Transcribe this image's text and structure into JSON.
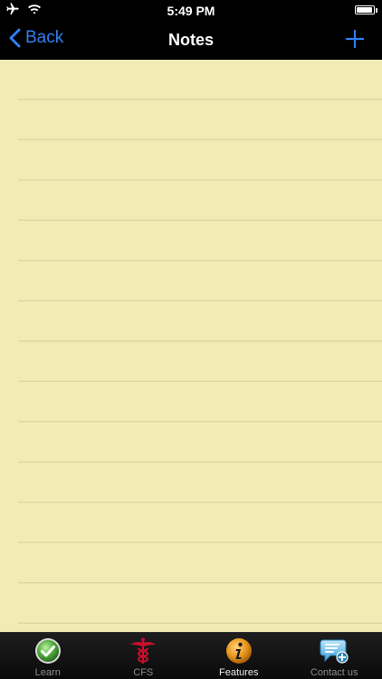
{
  "status_bar": {
    "time": "5:49 PM",
    "icons": [
      "airplane-icon",
      "wifi-icon",
      "battery-icon"
    ],
    "battery_level": 0.95
  },
  "nav_bar": {
    "back_label": "Back",
    "title": "Notes",
    "add_icon": "plus-icon"
  },
  "notepad": {
    "content": ""
  },
  "tab_bar": {
    "tabs": [
      {
        "label": "Learn",
        "icon": "checkmark-icon",
        "active": false
      },
      {
        "label": "CFS",
        "icon": "caduceus-icon",
        "active": false
      },
      {
        "label": "Features",
        "icon": "info-icon",
        "active": true
      },
      {
        "label": "Contact us",
        "icon": "chat-bubble-icon",
        "active": false
      }
    ]
  },
  "colors": {
    "accent": "#2f7ef2",
    "notepad_bg": "#f2ebb4",
    "notepad_line": "#ded8a7",
    "bar_bg": "#000000"
  }
}
